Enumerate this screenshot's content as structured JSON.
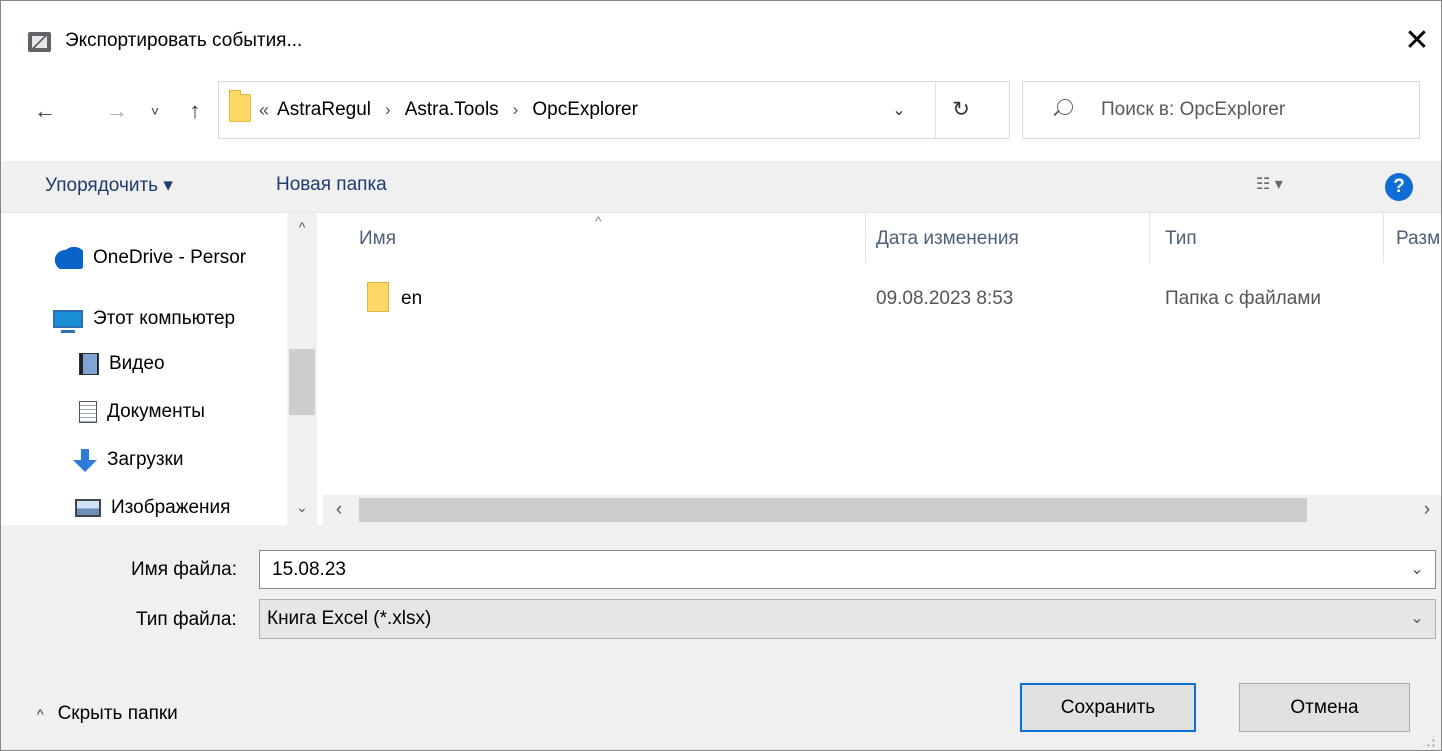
{
  "window": {
    "title": "Экспортировать события..."
  },
  "nav": {
    "back": "←",
    "forward": "→",
    "recent": "˅",
    "up": "↑"
  },
  "address": {
    "lead": "«",
    "crumbs": [
      "AstraRegul",
      "Astra.Tools",
      "OpcExplorer"
    ],
    "separator": "›"
  },
  "search": {
    "placeholder": "Поиск в: OpcExplorer"
  },
  "toolbar": {
    "organize": "Упорядочить ▾",
    "new_folder": "Новая папка",
    "view_caret": "▾",
    "help": "?"
  },
  "sidebar": {
    "items": [
      {
        "label": "OneDrive - Persor",
        "icon": "onedrive-cloud-icon"
      },
      {
        "label": "Этот компьютер",
        "icon": "computer-icon"
      },
      {
        "label": "Видео",
        "icon": "video-icon"
      },
      {
        "label": "Документы",
        "icon": "documents-icon"
      },
      {
        "label": "Загрузки",
        "icon": "downloads-icon"
      },
      {
        "label": "Изображения",
        "icon": "pictures-icon"
      }
    ]
  },
  "filelist": {
    "columns": [
      "Имя",
      "Дата изменения",
      "Тип",
      "Разм"
    ],
    "rows": [
      {
        "name": "en",
        "modified": "09.08.2023 8:53",
        "type": "Папка с файлами",
        "size": ""
      }
    ]
  },
  "form": {
    "filename_label": "Имя файла:",
    "filename_value": "15.08.23",
    "filetype_label": "Тип файла:",
    "filetype_value": "Книга Excel (*.xlsx)"
  },
  "footer": {
    "hide_folders": "Скрыть папки",
    "save": "Сохранить",
    "cancel": "Отмена"
  },
  "colors": {
    "accent": "#0a6fd4",
    "folder": "#ffd766",
    "toolbar_text": "#1e3c6e"
  }
}
